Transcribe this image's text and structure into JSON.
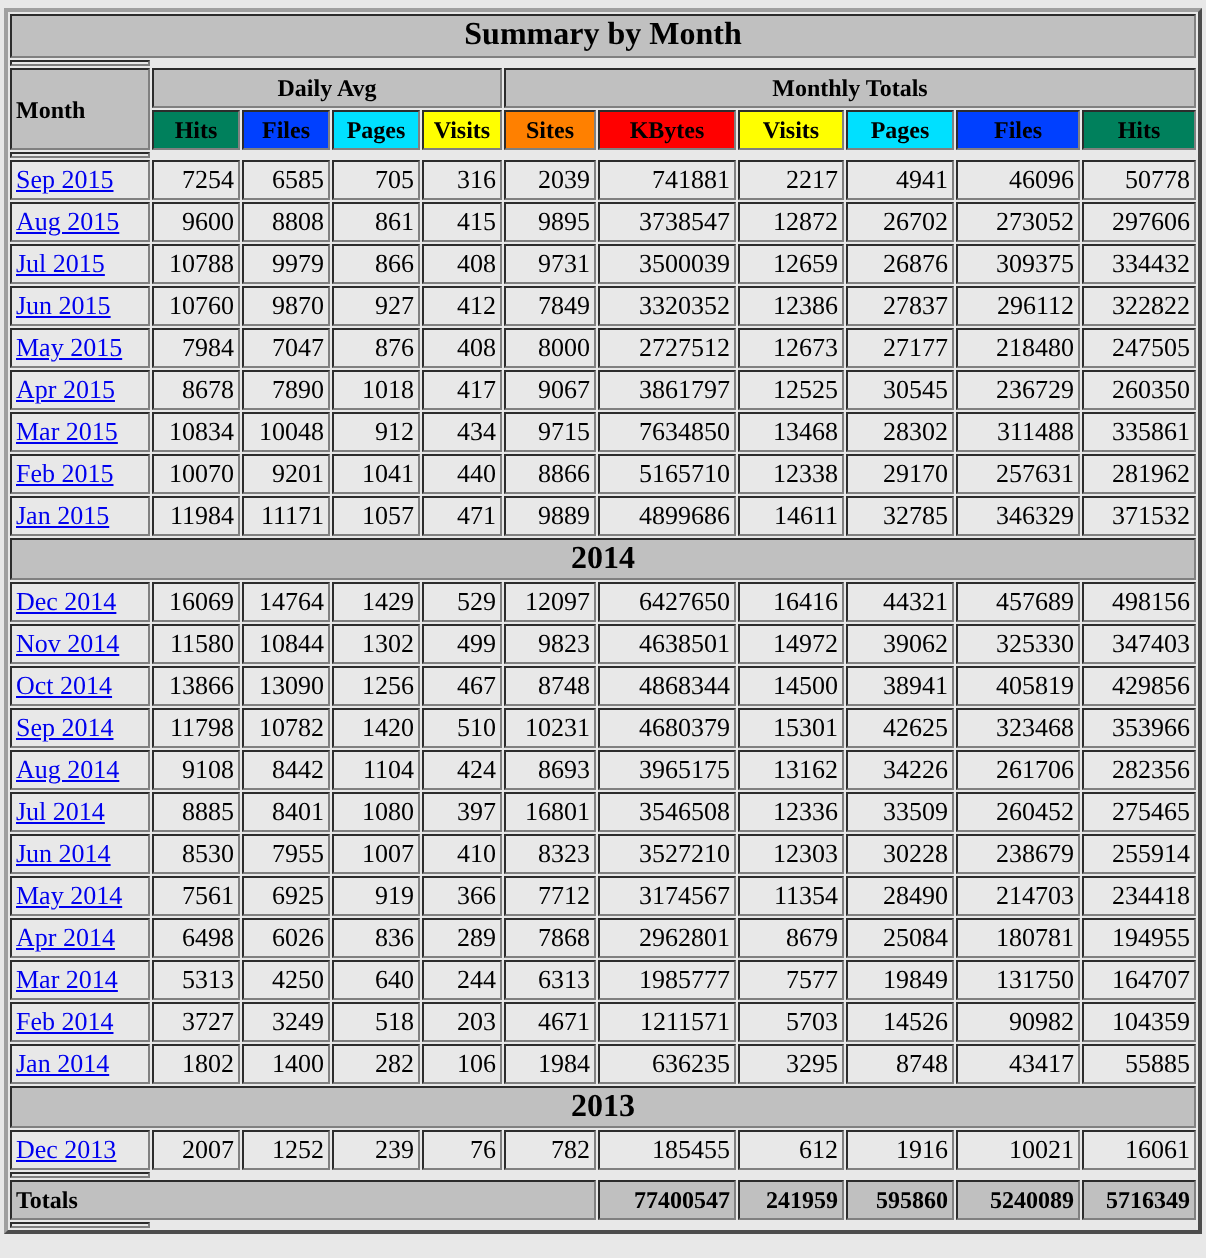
{
  "title": "Summary by Month",
  "month_header": "Month",
  "groups": [
    {
      "label": "Daily Avg",
      "columns": [
        {
          "label": "Hits",
          "color": "#00805c"
        },
        {
          "label": "Files",
          "color": "#0040ff"
        },
        {
          "label": "Pages",
          "color": "#00e0ff"
        },
        {
          "label": "Visits",
          "color": "#ffff00"
        }
      ]
    },
    {
      "label": "Monthly Totals",
      "columns": [
        {
          "label": "Sites",
          "color": "#ff8000"
        },
        {
          "label": "KBytes",
          "color": "#ff0000"
        },
        {
          "label": "Visits",
          "color": "#ffff00"
        },
        {
          "label": "Pages",
          "color": "#00e0ff"
        },
        {
          "label": "Files",
          "color": "#0040ff"
        },
        {
          "label": "Hits",
          "color": "#00805c"
        }
      ]
    }
  ],
  "sections": [
    {
      "rows": [
        {
          "month": "Sep 2015",
          "values": [
            "7254",
            "6585",
            "705",
            "316",
            "2039",
            "741881",
            "2217",
            "4941",
            "46096",
            "50778"
          ]
        },
        {
          "month": "Aug 2015",
          "values": [
            "9600",
            "8808",
            "861",
            "415",
            "9895",
            "3738547",
            "12872",
            "26702",
            "273052",
            "297606"
          ]
        },
        {
          "month": "Jul 2015",
          "values": [
            "10788",
            "9979",
            "866",
            "408",
            "9731",
            "3500039",
            "12659",
            "26876",
            "309375",
            "334432"
          ]
        },
        {
          "month": "Jun 2015",
          "values": [
            "10760",
            "9870",
            "927",
            "412",
            "7849",
            "3320352",
            "12386",
            "27837",
            "296112",
            "322822"
          ]
        },
        {
          "month": "May 2015",
          "values": [
            "7984",
            "7047",
            "876",
            "408",
            "8000",
            "2727512",
            "12673",
            "27177",
            "218480",
            "247505"
          ]
        },
        {
          "month": "Apr 2015",
          "values": [
            "8678",
            "7890",
            "1018",
            "417",
            "9067",
            "3861797",
            "12525",
            "30545",
            "236729",
            "260350"
          ]
        },
        {
          "month": "Mar 2015",
          "values": [
            "10834",
            "10048",
            "912",
            "434",
            "9715",
            "7634850",
            "13468",
            "28302",
            "311488",
            "335861"
          ]
        },
        {
          "month": "Feb 2015",
          "values": [
            "10070",
            "9201",
            "1041",
            "440",
            "8866",
            "5165710",
            "12338",
            "29170",
            "257631",
            "281962"
          ]
        },
        {
          "month": "Jan 2015",
          "values": [
            "11984",
            "11171",
            "1057",
            "471",
            "9889",
            "4899686",
            "14611",
            "32785",
            "346329",
            "371532"
          ]
        }
      ]
    },
    {
      "heading": "2014",
      "rows": [
        {
          "month": "Dec 2014",
          "values": [
            "16069",
            "14764",
            "1429",
            "529",
            "12097",
            "6427650",
            "16416",
            "44321",
            "457689",
            "498156"
          ]
        },
        {
          "month": "Nov 2014",
          "values": [
            "11580",
            "10844",
            "1302",
            "499",
            "9823",
            "4638501",
            "14972",
            "39062",
            "325330",
            "347403"
          ]
        },
        {
          "month": "Oct 2014",
          "values": [
            "13866",
            "13090",
            "1256",
            "467",
            "8748",
            "4868344",
            "14500",
            "38941",
            "405819",
            "429856"
          ]
        },
        {
          "month": "Sep 2014",
          "values": [
            "11798",
            "10782",
            "1420",
            "510",
            "10231",
            "4680379",
            "15301",
            "42625",
            "323468",
            "353966"
          ]
        },
        {
          "month": "Aug 2014",
          "values": [
            "9108",
            "8442",
            "1104",
            "424",
            "8693",
            "3965175",
            "13162",
            "34226",
            "261706",
            "282356"
          ]
        },
        {
          "month": "Jul 2014",
          "values": [
            "8885",
            "8401",
            "1080",
            "397",
            "16801",
            "3546508",
            "12336",
            "33509",
            "260452",
            "275465"
          ]
        },
        {
          "month": "Jun 2014",
          "values": [
            "8530",
            "7955",
            "1007",
            "410",
            "8323",
            "3527210",
            "12303",
            "30228",
            "238679",
            "255914"
          ]
        },
        {
          "month": "May 2014",
          "values": [
            "7561",
            "6925",
            "919",
            "366",
            "7712",
            "3174567",
            "11354",
            "28490",
            "214703",
            "234418"
          ]
        },
        {
          "month": "Apr 2014",
          "values": [
            "6498",
            "6026",
            "836",
            "289",
            "7868",
            "2962801",
            "8679",
            "25084",
            "180781",
            "194955"
          ]
        },
        {
          "month": "Mar 2014",
          "values": [
            "5313",
            "4250",
            "640",
            "244",
            "6313",
            "1985777",
            "7577",
            "19849",
            "131750",
            "164707"
          ]
        },
        {
          "month": "Feb 2014",
          "values": [
            "3727",
            "3249",
            "518",
            "203",
            "4671",
            "1211571",
            "5703",
            "14526",
            "90982",
            "104359"
          ]
        },
        {
          "month": "Jan 2014",
          "values": [
            "1802",
            "1400",
            "282",
            "106",
            "1984",
            "636235",
            "3295",
            "8748",
            "43417",
            "55885"
          ]
        }
      ]
    },
    {
      "heading": "2013",
      "rows": [
        {
          "month": "Dec 2013",
          "values": [
            "2007",
            "1252",
            "239",
            "76",
            "782",
            "185455",
            "612",
            "1916",
            "10021",
            "16061"
          ]
        }
      ]
    }
  ],
  "totals": {
    "label": "Totals",
    "values": [
      "77400547",
      "241959",
      "595860",
      "5240089",
      "5716349"
    ]
  }
}
